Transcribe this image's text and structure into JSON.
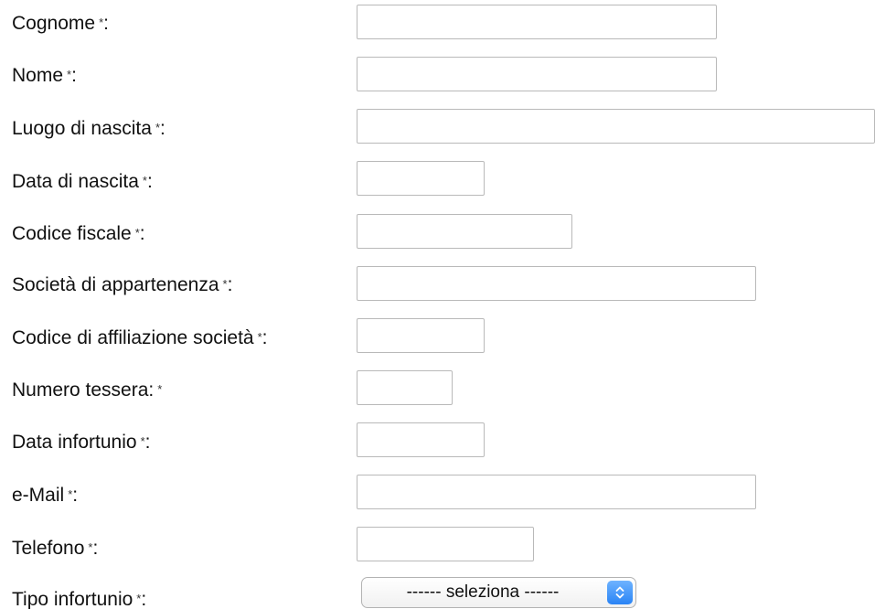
{
  "form": {
    "required_marker": "*",
    "fields": [
      {
        "label": "Cognome",
        "suffix": ":",
        "value": ""
      },
      {
        "label": "Nome",
        "suffix": ":",
        "value": ""
      },
      {
        "label": "Luogo di nascita",
        "suffix": ":",
        "value": ""
      },
      {
        "label": "Data di nascita",
        "suffix": ":",
        "value": ""
      },
      {
        "label": "Codice fiscale",
        "suffix": ":",
        "value": ""
      },
      {
        "label": "Società di appartenenza",
        "suffix": ":",
        "value": ""
      },
      {
        "label": "Codice di affiliazione società",
        "suffix": ":",
        "value": ""
      },
      {
        "label": "Numero tessera:",
        "suffix": "",
        "value": ""
      },
      {
        "label": "Data infortunio",
        "suffix": ":",
        "value": ""
      },
      {
        "label": "e-Mail",
        "suffix": ":",
        "value": ""
      },
      {
        "label": "Telefono",
        "suffix": ":",
        "value": ""
      }
    ],
    "tipo_infortunio": {
      "label": "Tipo infortunio",
      "suffix": ":",
      "selected": "------ seleziona ------",
      "icon": "up-down-chevron-icon"
    }
  },
  "colors": {
    "field_border": "#b9b9b9",
    "select_button": "#2a84f5"
  }
}
